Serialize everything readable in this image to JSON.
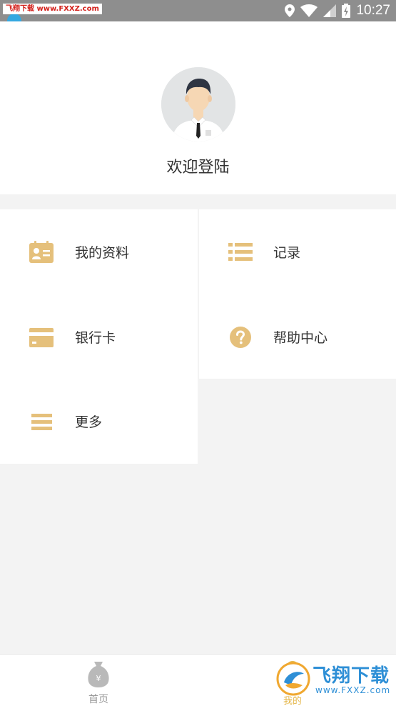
{
  "status_bar": {
    "watermark_text": "飞翔下载 www.FXXZ.com",
    "time": "10:27",
    "icons": [
      "location-icon",
      "wifi-icon",
      "signal-icon",
      "battery-charging-icon"
    ]
  },
  "profile": {
    "avatar_icon": "user-avatar-icon",
    "welcome_text": "欢迎登陆"
  },
  "menu": {
    "my_profile": {
      "label": "我的资料",
      "icon": "id-card-icon"
    },
    "records": {
      "label": "记录",
      "icon": "list-icon"
    },
    "bank_card": {
      "label": "银行卡",
      "icon": "credit-card-icon"
    },
    "help_center": {
      "label": "帮助中心",
      "icon": "question-icon"
    },
    "more": {
      "label": "更多",
      "icon": "menu-lines-icon"
    }
  },
  "bottom_nav": {
    "home": {
      "label": "首页",
      "icon": "money-bag-icon"
    },
    "mine": {
      "label": "我的",
      "icon": "user-icon"
    }
  },
  "watermark": {
    "title": "飞翔下载",
    "url": "www.FXXZ.com"
  },
  "colors": {
    "accent": "#e5c07b",
    "background": "#f3f3f3",
    "status_bar": "#8e8e8e"
  }
}
